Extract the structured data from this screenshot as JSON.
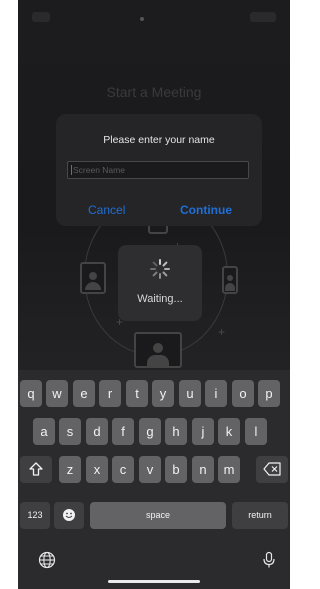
{
  "screen": {
    "title": "Start a Meeting"
  },
  "dialog": {
    "title": "Please enter your name",
    "input_placeholder": "Screen Name",
    "cancel_label": "Cancel",
    "continue_label": "Continue"
  },
  "status": {
    "waiting_label": "Waiting..."
  },
  "keyboard": {
    "row1": [
      "q",
      "w",
      "e",
      "r",
      "t",
      "y",
      "u",
      "i",
      "o",
      "p"
    ],
    "row2": [
      "a",
      "s",
      "d",
      "f",
      "g",
      "h",
      "j",
      "k",
      "l"
    ],
    "row3": [
      "z",
      "x",
      "c",
      "v",
      "b",
      "n",
      "m"
    ],
    "numbers_label": "123",
    "space_label": "space",
    "return_label": "return",
    "icons": [
      "shift-icon",
      "delete-icon",
      "emoji-icon",
      "globe-icon",
      "microphone-icon"
    ]
  },
  "colors": {
    "accent": "#1f6fd6",
    "background": "#000000",
    "keyboard": "#2b2b2d",
    "key": "#636366"
  }
}
